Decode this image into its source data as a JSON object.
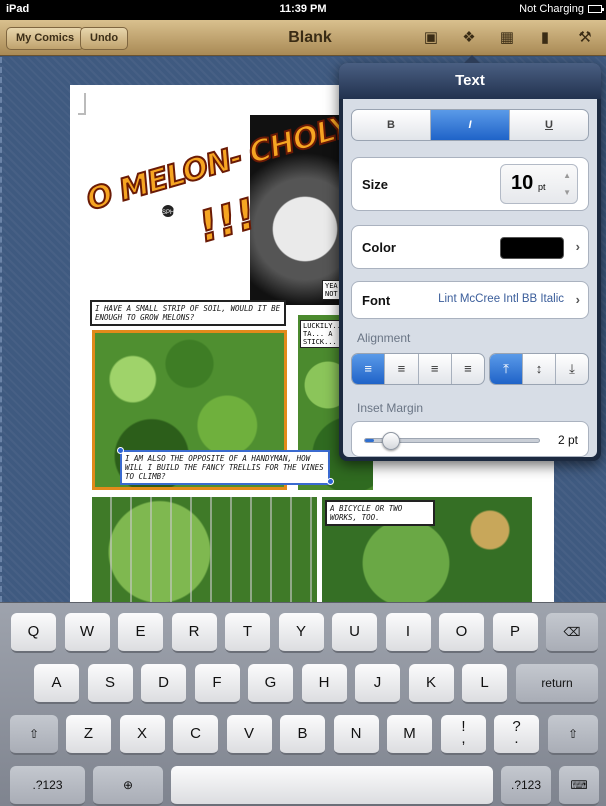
{
  "status": {
    "device": "iPad",
    "time": "11:39 PM",
    "charging": "Not Charging"
  },
  "toolbar": {
    "my_comics": "My Comics",
    "undo": "Undo",
    "title": "Blank",
    "icons": [
      "book-icon",
      "info-icon",
      "image-icon",
      "page-icon",
      "wrench-icon"
    ]
  },
  "comic": {
    "title_line1": "O MELON- CHOLY",
    "title_line2": "!!!",
    "sfx": "SPH",
    "caption1": "I have a small strip of soil, would it be enough to grow melons?",
    "caption2": "I am also the opposite of a handyman, how will I build the fancy trellis for the vines to climb?",
    "caption3": "A bicycle or two works, too.",
    "caption_small_a": "YEA... NOT...",
    "caption_small_b": "LUCKILY... NEED TA... A STICK..."
  },
  "popover": {
    "title": "Text",
    "style_buttons": [
      "B",
      "I",
      "U"
    ],
    "style_active": "I",
    "size_label": "Size",
    "size_value": "10",
    "size_unit": "pt",
    "color_label": "Color",
    "color_value": "#000000",
    "font_label": "Font",
    "font_value": "Lint McCree Intl BB Italic",
    "alignment_label": "Alignment",
    "inset_label": "Inset Margin",
    "inset_value": "2 pt",
    "inset_fraction": 0.05
  },
  "keyboard": {
    "row1": [
      "Q",
      "W",
      "E",
      "R",
      "T",
      "Y",
      "U",
      "I",
      "O",
      "P"
    ],
    "row2": [
      "A",
      "S",
      "D",
      "F",
      "G",
      "H",
      "J",
      "K",
      "L"
    ],
    "row3": [
      "Z",
      "X",
      "C",
      "V",
      "B",
      "N",
      "M"
    ],
    "return": "return",
    "exclaim": "!",
    "comma": ",",
    "question": "?",
    "period": ".",
    "numbers": ".?123"
  }
}
